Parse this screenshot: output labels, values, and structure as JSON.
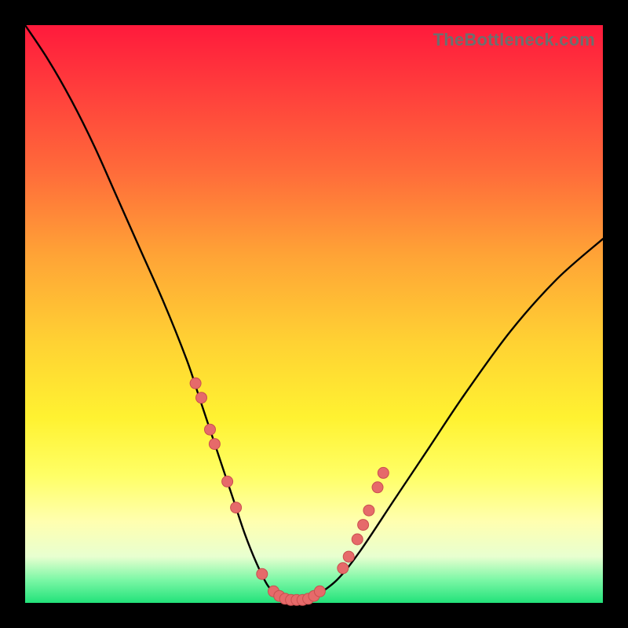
{
  "watermark": "TheBottleneck.com",
  "colors": {
    "frame": "#000000",
    "curve_stroke": "#000000",
    "marker_fill": "#e66a6a",
    "marker_stroke": "#c94f4f",
    "gradient_stops": [
      "#ff1a3c",
      "#ff3a3c",
      "#ff6a3a",
      "#ffa436",
      "#ffd233",
      "#fff231",
      "#ffff66",
      "#ffffb0",
      "#e8ffd0",
      "#7cf7a6",
      "#22e27a"
    ]
  },
  "chart_data": {
    "type": "line",
    "title": "",
    "xlabel": "",
    "ylabel": "",
    "xlim": [
      0,
      100
    ],
    "ylim": [
      0,
      100
    ],
    "annotations": [
      "TheBottleneck.com"
    ],
    "series": [
      {
        "name": "bottleneck-curve",
        "x": [
          0,
          4,
          8,
          12,
          16,
          20,
          24,
          28,
          30,
          32,
          34,
          36,
          38,
          40,
          42,
          44,
          46,
          48,
          50,
          54,
          58,
          64,
          70,
          76,
          84,
          92,
          100
        ],
        "y": [
          100,
          94,
          87,
          79,
          70,
          61,
          52,
          42,
          36,
          30,
          24,
          18,
          12,
          7,
          3,
          1,
          0,
          0,
          1,
          4,
          9,
          18,
          27,
          36,
          47,
          56,
          63
        ]
      }
    ],
    "markers": {
      "name": "fit-markers",
      "x": [
        29.5,
        30.5,
        32.0,
        32.8,
        35.0,
        36.5,
        41.0,
        43.0,
        44.0,
        45.0,
        46.0,
        47.0,
        48.0,
        49.0,
        50.0,
        51.0,
        55.0,
        56.0,
        57.5,
        58.5,
        59.5,
        61.0,
        62.0
      ],
      "y": [
        38.0,
        35.5,
        30.0,
        27.5,
        21.0,
        16.5,
        5.0,
        2.0,
        1.2,
        0.7,
        0.5,
        0.5,
        0.5,
        0.7,
        1.2,
        2.0,
        6.0,
        8.0,
        11.0,
        13.5,
        16.0,
        20.0,
        22.5
      ]
    }
  }
}
